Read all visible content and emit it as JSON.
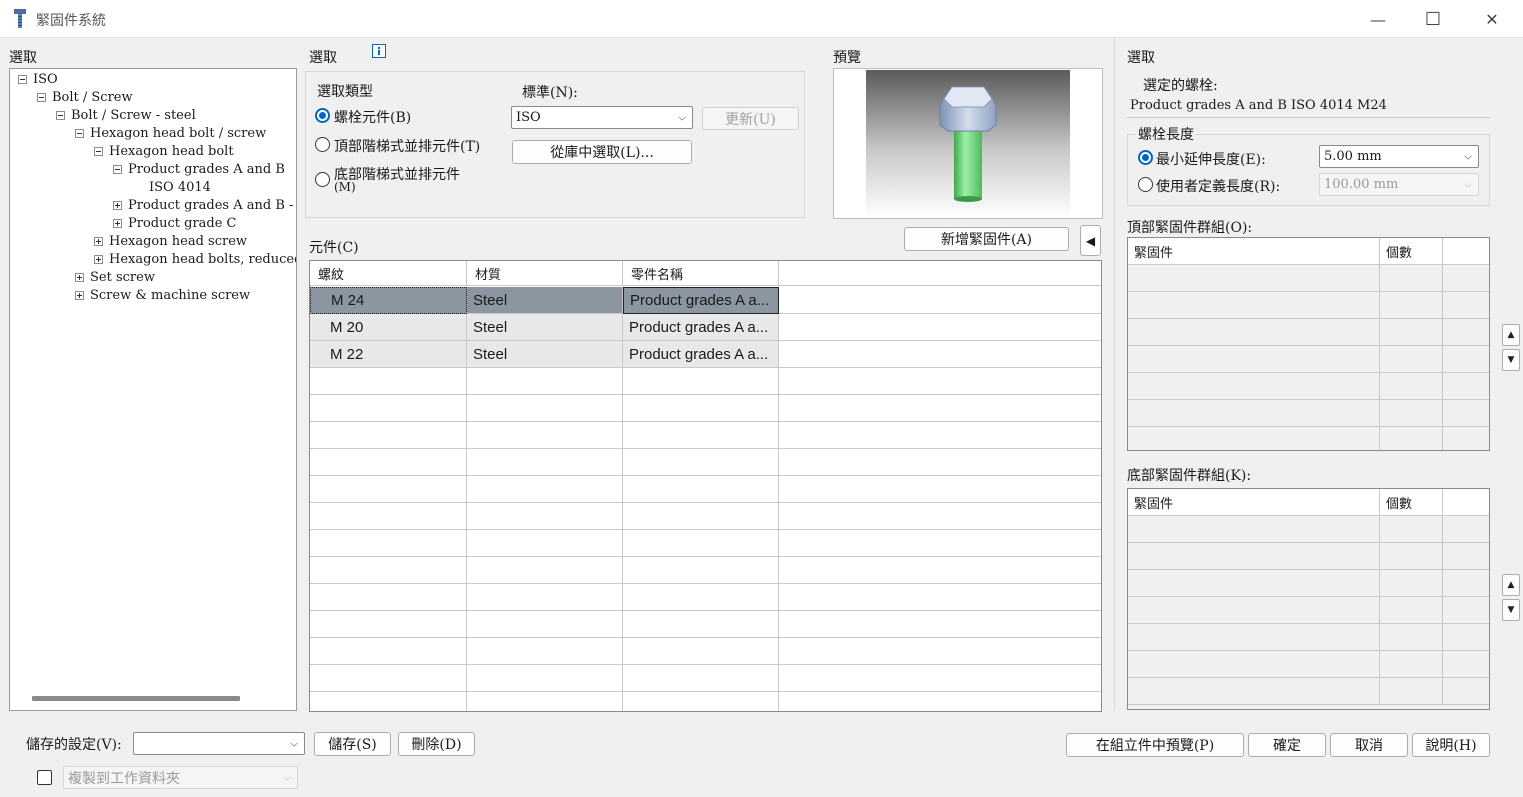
{
  "window": {
    "title": "緊固件系統",
    "minimize_glyph": "—",
    "maximize_glyph": "☐",
    "close_glyph": "✕"
  },
  "tree_panel": {
    "label": "選取",
    "items": [
      {
        "label": "ISO",
        "expander": "minus"
      },
      {
        "label": "Bolt / Screw",
        "expander": "minus"
      },
      {
        "label": "Bolt / Screw - steel",
        "expander": "minus"
      },
      {
        "label": "Hexagon head bolt / screw",
        "expander": "minus"
      },
      {
        "label": "Hexagon head bolt",
        "expander": "minus"
      },
      {
        "label": "Product grades A and B",
        "expander": "minus"
      },
      {
        "label": "ISO 4014",
        "expander": "none"
      },
      {
        "label": "Product grades A and B - fine",
        "expander": "plus"
      },
      {
        "label": "Product grade C",
        "expander": "plus"
      },
      {
        "label": "Hexagon head screw",
        "expander": "plus"
      },
      {
        "label": "Hexagon head bolts, reduced sha",
        "expander": "plus"
      },
      {
        "label": "Set screw",
        "expander": "plus"
      },
      {
        "label": "Screw & machine screw",
        "expander": "plus"
      }
    ]
  },
  "selection": {
    "label": "選取",
    "info_icon": "info-icon",
    "type_label": "選取類型",
    "types": [
      {
        "label": "螺栓元件(B)",
        "selected": true
      },
      {
        "label": "頂部階梯式並排元件(T)",
        "selected": false
      },
      {
        "label": "底部階梯式並排元件",
        "label_line2": "(M)",
        "selected": false
      }
    ],
    "standard_label": "標準(N):",
    "standard_value": "ISO",
    "update_button": "更新(U)",
    "library_button": "從庫中選取(L)..."
  },
  "preview": {
    "label": "預覽"
  },
  "components": {
    "label": "元件(C)",
    "add_button": "新增緊固件(A)",
    "collapse_glyph": "◀",
    "columns": [
      "螺紋",
      "材質",
      "零件名稱"
    ],
    "rows": [
      {
        "thread": "M 24",
        "material": "Steel",
        "name": "Product grades A a...",
        "selected": true
      },
      {
        "thread": "M 20",
        "material": "Steel",
        "name": "Product grades A a...",
        "selected": false
      },
      {
        "thread": "M 22",
        "material": "Steel",
        "name": "Product grades A a...",
        "selected": false
      }
    ]
  },
  "right_panel": {
    "label": "選取",
    "selected_bolt_label": "選定的螺栓:",
    "selected_bolt_value": "Product grades A and B ISO 4014 M24",
    "length_label": "螺栓長度",
    "length_options": [
      {
        "label": "最小延伸長度(E):",
        "selected": true,
        "value": "5.00 mm",
        "enabled": true
      },
      {
        "label": "使用者定義長度(R):",
        "selected": false,
        "value": "100.00 mm",
        "enabled": false
      }
    ],
    "top_group_label": "頂部緊固件群組(O):",
    "bottom_group_label": "底部緊固件群組(K):",
    "group_columns": [
      "緊固件",
      "個數"
    ],
    "up_glyph": "▲",
    "down_glyph": "▼"
  },
  "footer": {
    "saved_settings_label": "儲存的設定(V):",
    "saved_settings_value": "",
    "save_button": "儲存(S)",
    "delete_button": "刪除(D)",
    "copy_label": "複製到工作資料夾",
    "preview_in_assembly": "在組立件中預覽(P)",
    "ok_button": "確定",
    "cancel_button": "取消",
    "help_button": "說明(H)"
  },
  "colors": {
    "accent": "#0067c0",
    "selected_row": "#8c96a0",
    "grey_row": "#e8e8e8"
  }
}
